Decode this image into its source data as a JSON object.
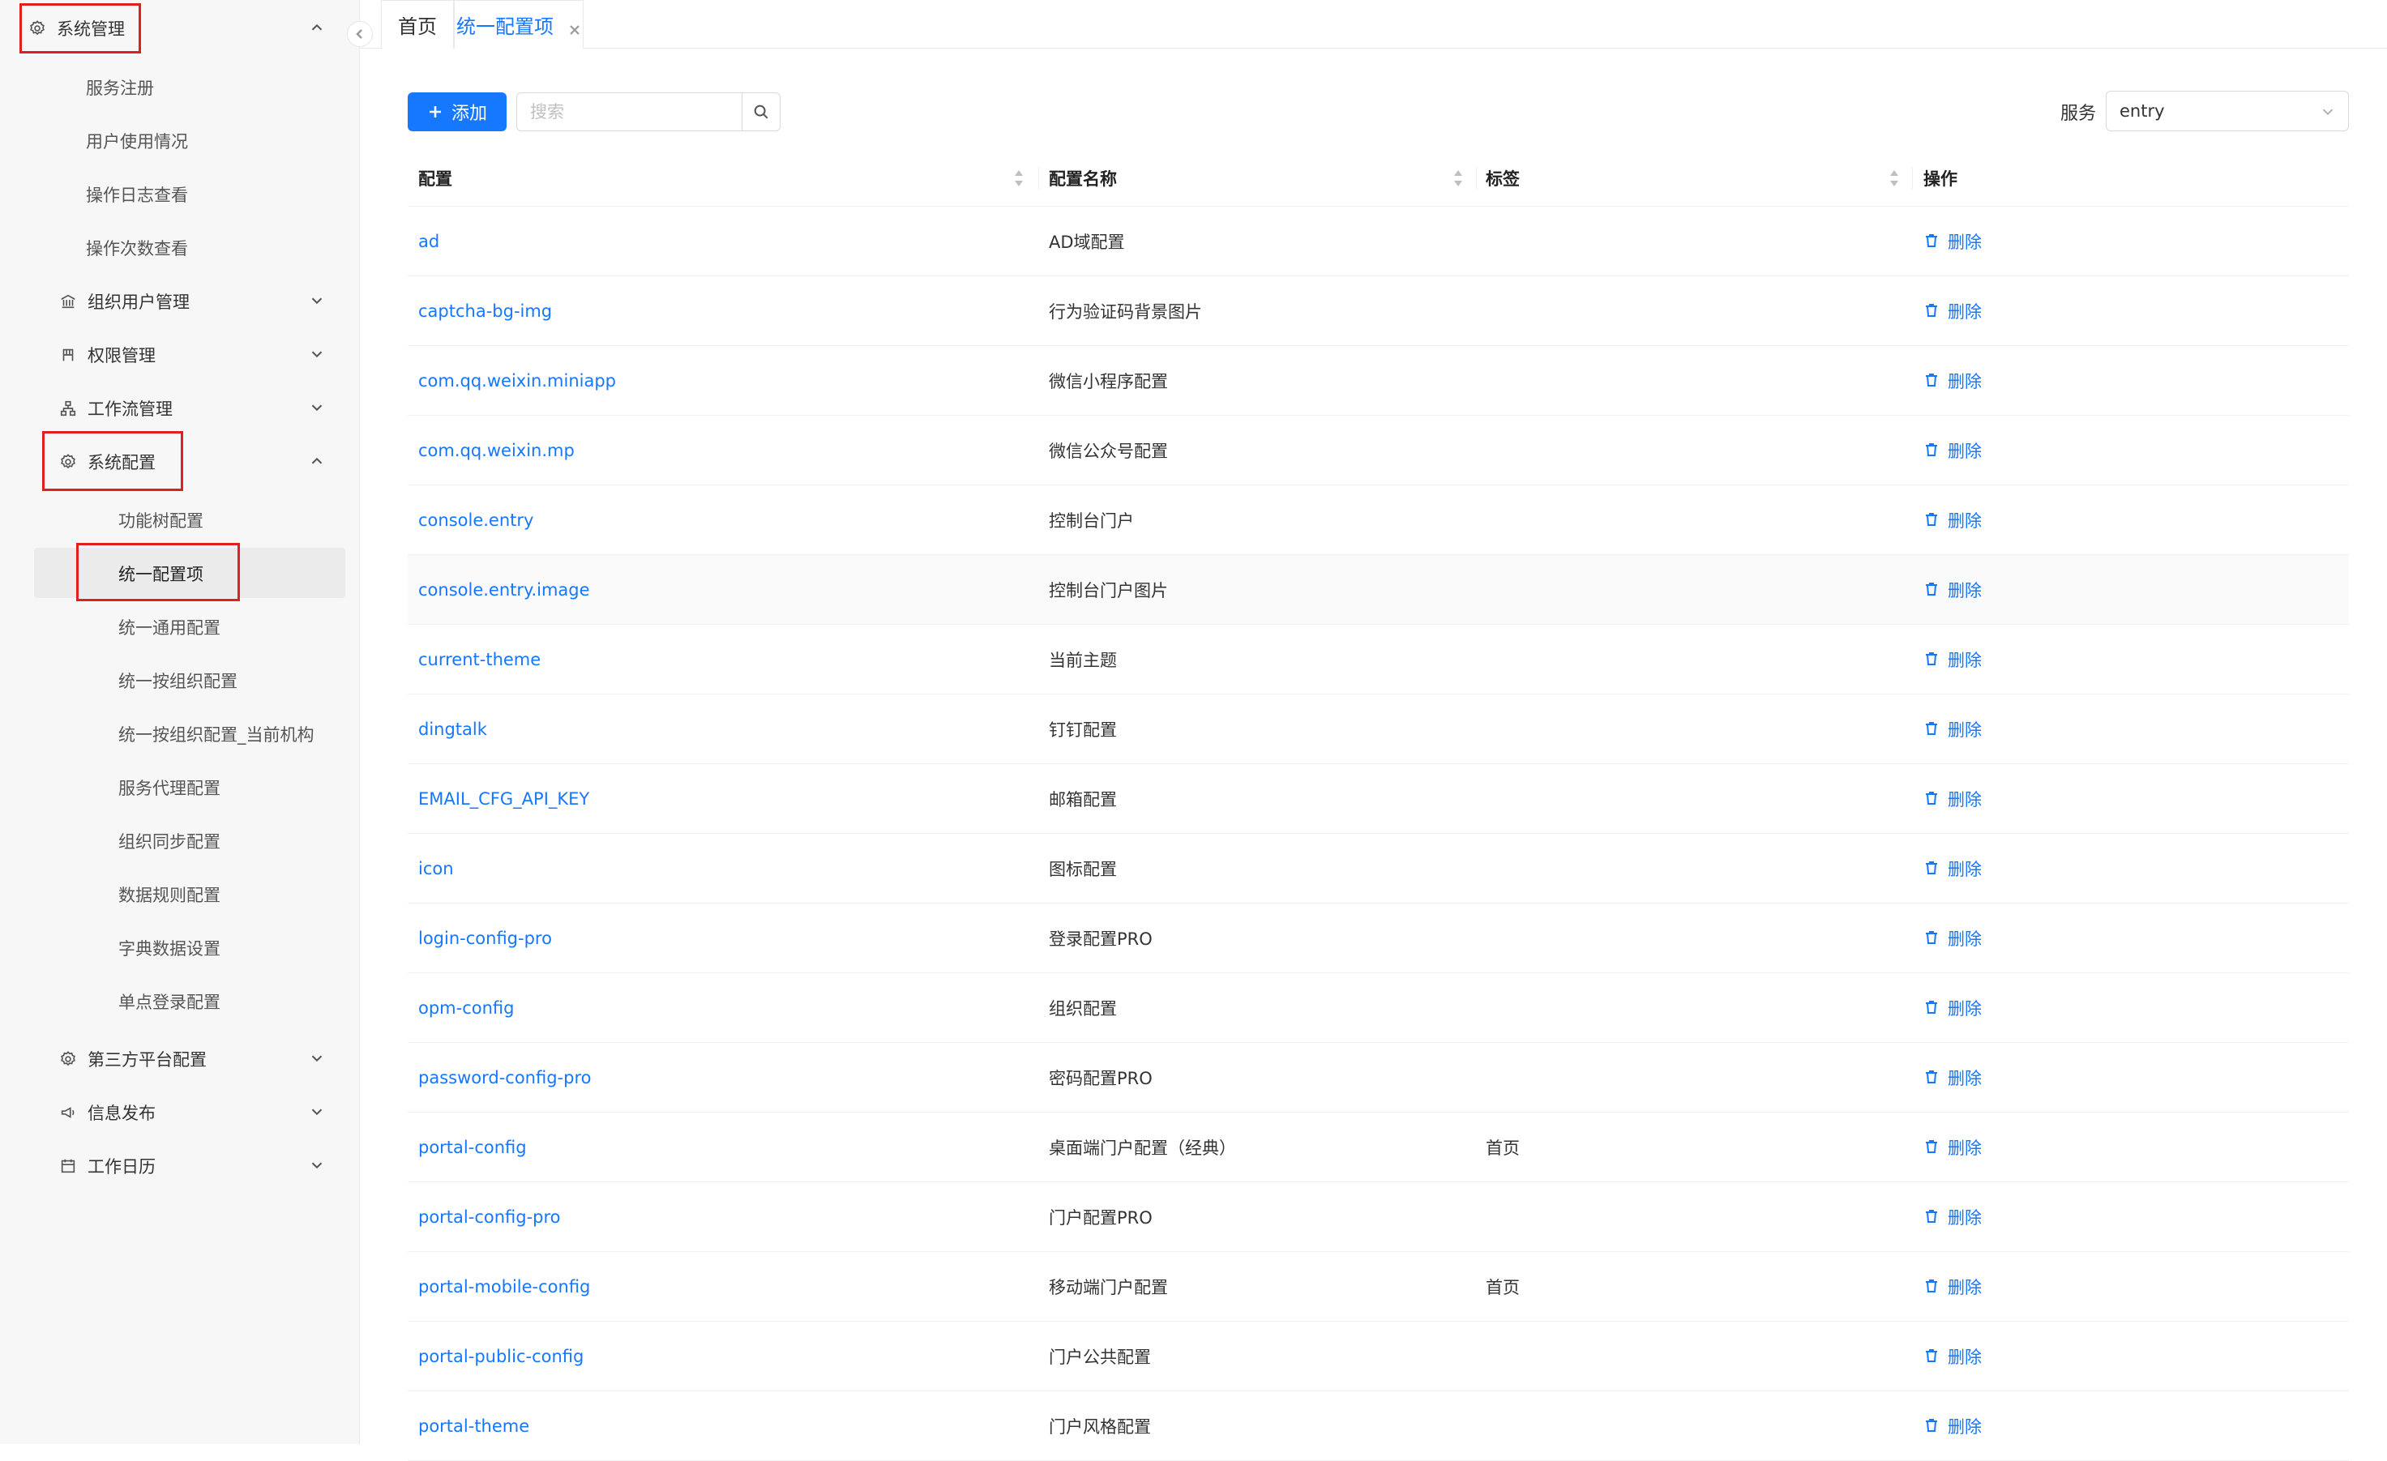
{
  "sidebar": {
    "top": {
      "label": "系统管理"
    },
    "items": [
      {
        "label": "服务注册"
      },
      {
        "label": "用户使用情况"
      },
      {
        "label": "操作日志查看"
      },
      {
        "label": "操作次数查看"
      },
      {
        "label": "组织用户管理"
      },
      {
        "label": "权限管理"
      },
      {
        "label": "工作流管理"
      },
      {
        "label": "系统配置"
      },
      {
        "label": "功能树配置"
      },
      {
        "label": "统一配置项"
      },
      {
        "label": "统一通用配置"
      },
      {
        "label": "统一按组织配置"
      },
      {
        "label": "统一按组织配置_当前机构"
      },
      {
        "label": "服务代理配置"
      },
      {
        "label": "组织同步配置"
      },
      {
        "label": "数据规则配置"
      },
      {
        "label": "字典数据设置"
      },
      {
        "label": "单点登录配置"
      },
      {
        "label": "第三方平台配置"
      },
      {
        "label": "信息发布"
      },
      {
        "label": "工作日历"
      }
    ]
  },
  "tabs": [
    {
      "label": "首页"
    },
    {
      "label": "统一配置项"
    }
  ],
  "toolbar": {
    "add_label": "添加",
    "search_placeholder": "搜索",
    "service_label": "服务",
    "service_value": "entry"
  },
  "table": {
    "columns": [
      "配置",
      "配置名称",
      "标签",
      "操作"
    ],
    "rows": [
      {
        "key": "ad",
        "name": "AD域配置",
        "tag": "",
        "op": "删除"
      },
      {
        "key": "captcha-bg-img",
        "name": "行为验证码背景图片",
        "tag": "",
        "op": "删除"
      },
      {
        "key": "com.qq.weixin.miniapp",
        "name": "微信小程序配置",
        "tag": "",
        "op": "删除"
      },
      {
        "key": "com.qq.weixin.mp",
        "name": "微信公众号配置",
        "tag": "",
        "op": "删除"
      },
      {
        "key": "console.entry",
        "name": "控制台门户",
        "tag": "",
        "op": "删除"
      },
      {
        "key": "console.entry.image",
        "name": "控制台门户图片",
        "tag": "",
        "op": "删除"
      },
      {
        "key": "current-theme",
        "name": "当前主题",
        "tag": "",
        "op": "删除"
      },
      {
        "key": "dingtalk",
        "name": "钉钉配置",
        "tag": "",
        "op": "删除"
      },
      {
        "key": "EMAIL_CFG_API_KEY",
        "name": "邮箱配置",
        "tag": "",
        "op": "删除"
      },
      {
        "key": "icon",
        "name": "图标配置",
        "tag": "",
        "op": "删除"
      },
      {
        "key": "login-config-pro",
        "name": "登录配置PRO",
        "tag": "",
        "op": "删除"
      },
      {
        "key": "opm-config",
        "name": "组织配置",
        "tag": "",
        "op": "删除"
      },
      {
        "key": "password-config-pro",
        "name": "密码配置PRO",
        "tag": "",
        "op": "删除"
      },
      {
        "key": "portal-config",
        "name": "桌面端门户配置（经典）",
        "tag": "首页",
        "op": "删除"
      },
      {
        "key": "portal-config-pro",
        "name": "门户配置PRO",
        "tag": "",
        "op": "删除"
      },
      {
        "key": "portal-mobile-config",
        "name": "移动端门户配置",
        "tag": "首页",
        "op": "删除"
      },
      {
        "key": "portal-public-config",
        "name": "门户公共配置",
        "tag": "",
        "op": "删除"
      },
      {
        "key": "portal-theme",
        "name": "门户风格配置",
        "tag": "",
        "op": "删除"
      }
    ]
  }
}
